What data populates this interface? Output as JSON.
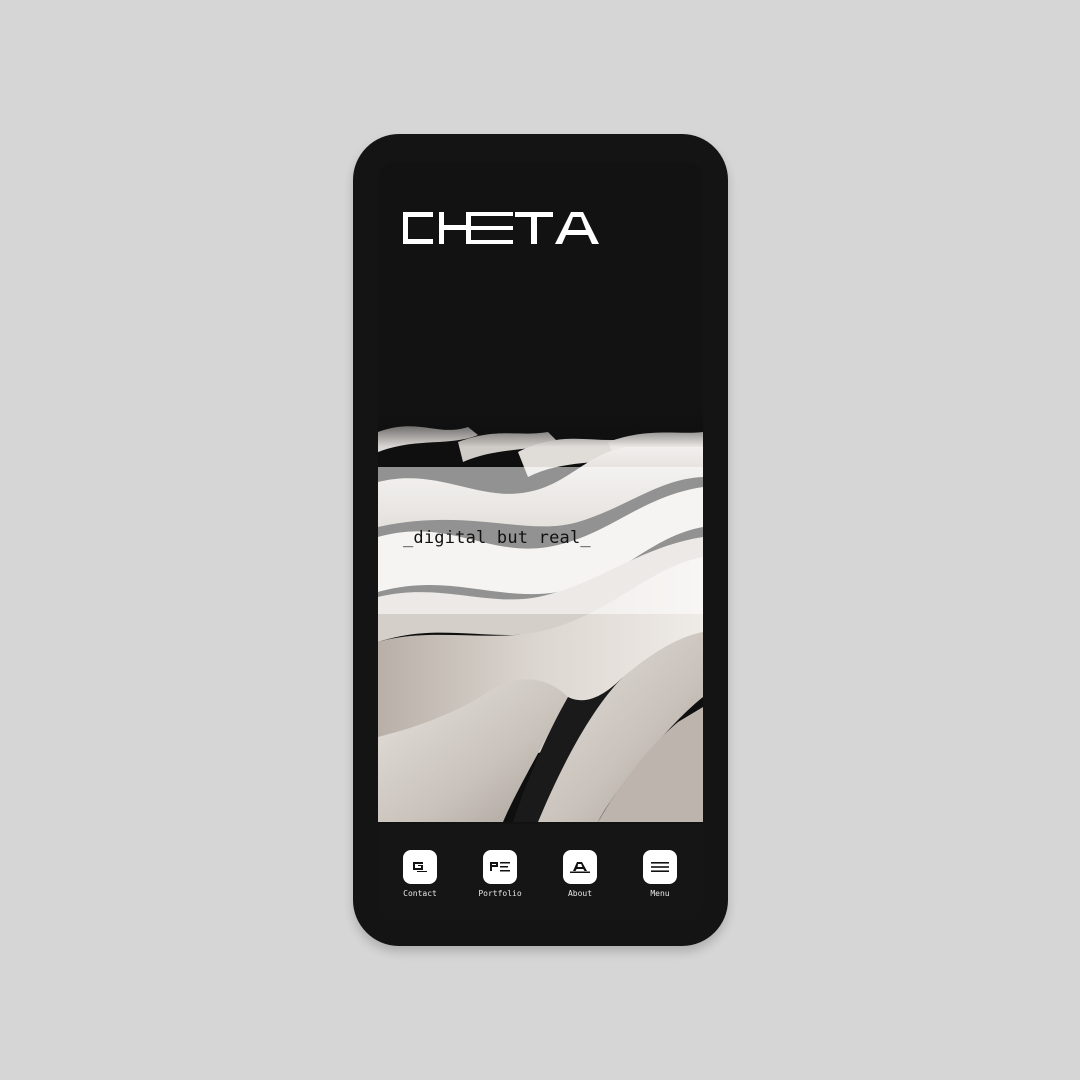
{
  "brand": {
    "logo_text": "CHETA"
  },
  "hero": {
    "tagline": "_digital but real_"
  },
  "nav": {
    "items": [
      {
        "label": "Contact",
        "icon": "contact-glyph-icon"
      },
      {
        "label": "Portfolio",
        "icon": "portfolio-glyph-icon"
      },
      {
        "label": "About",
        "icon": "about-glyph-icon"
      },
      {
        "label": "Menu",
        "icon": "hamburger-menu-icon"
      }
    ]
  },
  "colors": {
    "page_background": "#d6d6d6",
    "phone_frame": "#141414",
    "screen_background": "#121212",
    "logo": "#ffffff",
    "nav_button": "#ffffff",
    "nav_label": "#e8e8e8"
  }
}
